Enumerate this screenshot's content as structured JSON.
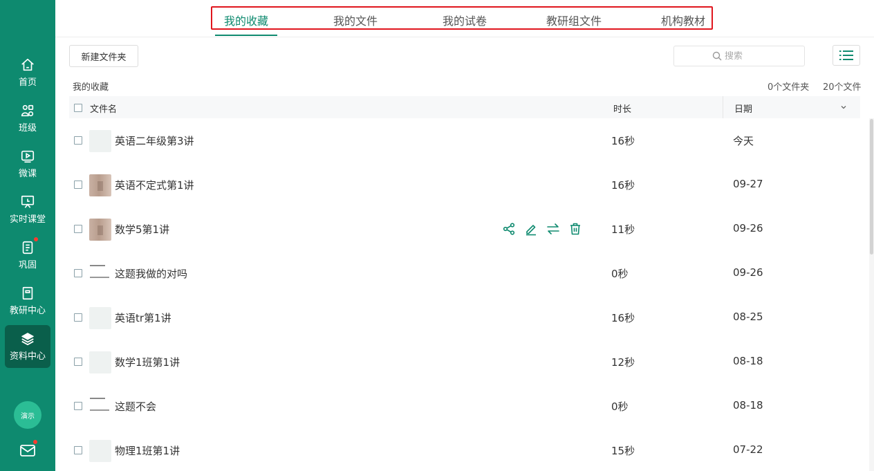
{
  "sidebar": {
    "items": [
      {
        "label": "首页",
        "icon": "home-icon"
      },
      {
        "label": "班级",
        "icon": "class-icon"
      },
      {
        "label": "微课",
        "icon": "video-icon"
      },
      {
        "label": "实时课堂",
        "icon": "live-classroom-icon"
      },
      {
        "label": "巩固",
        "icon": "notebook-icon",
        "badge": true
      },
      {
        "label": "教研中心",
        "icon": "book-icon"
      },
      {
        "label": "资料中心",
        "icon": "layers-icon",
        "active": true
      }
    ],
    "demo_label": "演示",
    "mail_icon": "mail-icon",
    "accent": "#0e8a6f",
    "active_bg": "#0a5f4b"
  },
  "tabs": [
    {
      "label": "我的收藏",
      "active": true
    },
    {
      "label": "我的文件"
    },
    {
      "label": "我的试卷"
    },
    {
      "label": "教研组文件"
    },
    {
      "label": "机构教材"
    }
  ],
  "toolbar": {
    "new_folder_label": "新建文件夹",
    "search_placeholder": "搜索"
  },
  "breadcrumb": "我的收藏",
  "counts": {
    "folders": "0个文件夹",
    "files": "20个文件"
  },
  "table": {
    "headers": {
      "name": "文件名",
      "duration": "时长",
      "date": "日期"
    },
    "rows": [
      {
        "name": "英语二年级第3讲",
        "duration": "16秒",
        "date": "今天",
        "thumb": "blank"
      },
      {
        "name": "英语不定式第1讲",
        "duration": "16秒",
        "date": "09-27",
        "thumb": "photo"
      },
      {
        "name": "数学5第1讲",
        "duration": "11秒",
        "date": "09-26",
        "thumb": "photo",
        "hover": true
      },
      {
        "name": "这题我做的对吗",
        "duration": "0秒",
        "date": "09-26",
        "thumb": "doc"
      },
      {
        "name": "英语tr第1讲",
        "duration": "16秒",
        "date": "08-25",
        "thumb": "blank"
      },
      {
        "name": "数学1班第1讲",
        "duration": "12秒",
        "date": "08-18",
        "thumb": "blank"
      },
      {
        "name": "这题不会",
        "duration": "0秒",
        "date": "08-18",
        "thumb": "doc"
      },
      {
        "name": "物理1班第1讲",
        "duration": "15秒",
        "date": "07-22",
        "thumb": "blank"
      }
    ]
  }
}
